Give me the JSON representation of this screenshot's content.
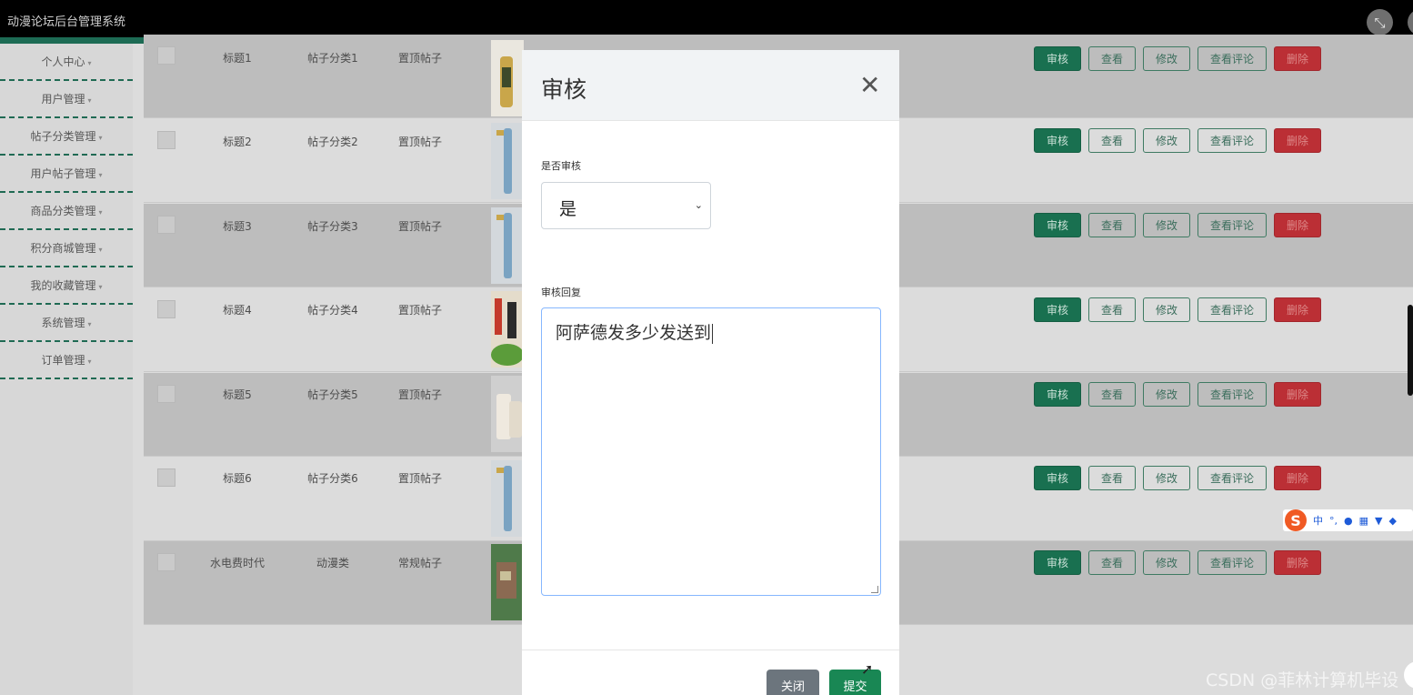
{
  "app": {
    "title": "动漫论坛后台管理系统",
    "fullscreen_icon": "fullscreen-exit-icon"
  },
  "sidebar": {
    "items": [
      {
        "label": "个人中心"
      },
      {
        "label": "用户管理"
      },
      {
        "label": "帖子分类管理"
      },
      {
        "label": "用户帖子管理"
      },
      {
        "label": "商品分类管理"
      },
      {
        "label": "积分商城管理"
      },
      {
        "label": "我的收藏管理"
      },
      {
        "label": "系统管理"
      },
      {
        "label": "订单管理"
      }
    ],
    "caret": "▾"
  },
  "table": {
    "rows": [
      {
        "title": "标题1",
        "category": "帖子分类1",
        "type": "置顶帖子"
      },
      {
        "title": "标题2",
        "category": "帖子分类2",
        "type": "置顶帖子"
      },
      {
        "title": "标题3",
        "category": "帖子分类3",
        "type": "置顶帖子"
      },
      {
        "title": "标题4",
        "category": "帖子分类4",
        "type": "置顶帖子"
      },
      {
        "title": "标题5",
        "category": "帖子分类5",
        "type": "置顶帖子"
      },
      {
        "title": "标题6",
        "category": "帖子分类6",
        "type": "置顶帖子"
      },
      {
        "title": "水电费时代",
        "category": "动漫类",
        "type": "常规帖子"
      }
    ],
    "actions": {
      "review": "审核",
      "view": "查看",
      "edit": "修改",
      "view_comments": "查看评论",
      "delete": "删除"
    }
  },
  "modal": {
    "title": "审核",
    "close_glyph": "✕",
    "field_review_label": "是否审核",
    "field_review_value": "是",
    "field_reply_label": "审核回复",
    "field_reply_value": "阿萨德发多少发送到",
    "close_button": "关闭",
    "submit_button": "提交"
  },
  "ime_toolbar": {
    "logo": "S",
    "mode": "中",
    "punct": "°,",
    "icons": [
      "microphone-icon",
      "keyboard-icon",
      "skin-icon",
      "apps-icon"
    ]
  },
  "watermark": "CSDN @菲林计算机毕设",
  "colors": {
    "primary": "#198754",
    "danger": "#dc3545",
    "secondary": "#6c757d",
    "topbar": "#000000",
    "accent_stripe": "#1d6b54"
  }
}
